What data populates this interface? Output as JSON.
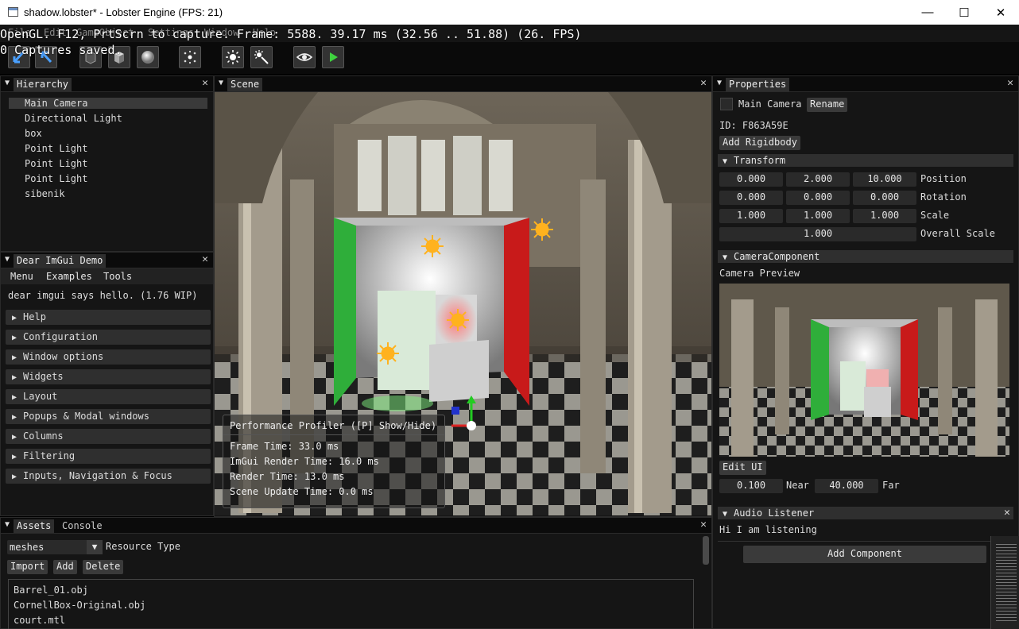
{
  "window": {
    "title": "shadow.lobster* - Lobster Engine (FPS: 21)",
    "controls": {
      "minimize": "—",
      "maximize": "☐",
      "close": "✕"
    }
  },
  "menubar": [
    "File",
    "Edit",
    "GameObject",
    "Settings",
    "Window",
    "Help"
  ],
  "overlay": {
    "line1": "OpenGL. F12, PrtScrn to capture. Frame: 5588. 39.17 ms (32.56 .. 51.88) (26. FPS)",
    "line2": "0 Captures saved."
  },
  "toolbar": {
    "icons": [
      "undo-icon",
      "redo-icon",
      "cube-dark-icon",
      "cube-icon",
      "sphere-icon",
      "particles-icon",
      "sun-icon",
      "spotlight-icon",
      "eye-icon",
      "play-icon"
    ]
  },
  "hierarchy": {
    "title": "Hierarchy",
    "items": [
      "Main Camera",
      "Directional Light",
      "box",
      "Point Light",
      "Point Light",
      "Point Light",
      "sibenik"
    ],
    "selected_index": 0
  },
  "imgui_demo": {
    "title": "Dear ImGui Demo",
    "menus": [
      "Menu",
      "Examples",
      "Tools"
    ],
    "hello": "dear imgui says hello. (1.76 WIP)",
    "sections": [
      "Help",
      "Configuration",
      "Window options",
      "Widgets",
      "Layout",
      "Popups & Modal windows",
      "Columns",
      "Filtering",
      "Inputs, Navigation & Focus"
    ]
  },
  "scene": {
    "title": "Scene",
    "profiler": {
      "title": "Performance Profiler ([P] Show/Hide)",
      "lines": [
        "Frame Time: 33.0 ms",
        "ImGui Render Time: 16.0 ms",
        "Render Time: 13.0 ms",
        "Scene Update Time: 0.0 ms"
      ]
    }
  },
  "properties": {
    "title": "Properties",
    "object_name": "Main Camera",
    "rename_label": "Rename",
    "id_text": "ID: F863A59E",
    "add_rigidbody": "Add Rigidbody",
    "transform": {
      "title": "Transform",
      "position": [
        "0.000",
        "2.000",
        "10.000"
      ],
      "position_label": "Position",
      "rotation": [
        "0.000",
        "0.000",
        "0.000"
      ],
      "rotation_label": "Rotation",
      "scale": [
        "1.000",
        "1.000",
        "1.000"
      ],
      "scale_label": "Scale",
      "overall_scale": "1.000",
      "overall_scale_label": "Overall Scale"
    },
    "camera": {
      "title": "CameraComponent",
      "preview_label": "Camera Preview",
      "edit_ui": "Edit UI",
      "near": "0.100",
      "near_label": "Near",
      "far": "40.000",
      "far_label": "Far"
    },
    "audio": {
      "title": "Audio Listener",
      "text": "Hi I am listening"
    },
    "add_component": "Add Component"
  },
  "assets": {
    "tabs": [
      "Assets",
      "Console"
    ],
    "resource_type_value": "meshes",
    "resource_type_label": "Resource Type",
    "buttons": [
      "Import",
      "Add",
      "Delete"
    ],
    "files": [
      "Barrel_01.obj",
      "CornellBox-Original.obj",
      "court.mtl"
    ]
  },
  "colors": {
    "panel_bg": "#151515",
    "title_tab": "#2e2e2e",
    "button": "#3a3a3a",
    "field": "#2a2a2a",
    "green_wall": "#2fae3a",
    "red_wall": "#c81a1a"
  }
}
